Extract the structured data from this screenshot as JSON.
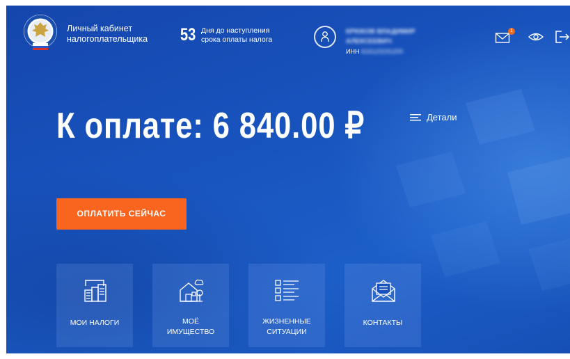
{
  "header": {
    "cabinet_title_line1": "Личный кабинет",
    "cabinet_title_line2": "налогоплательщика",
    "days_count": "53",
    "days_text_line1": "Дня до наступления",
    "days_text_line2": "срока оплаты налога",
    "user_name_line1": "Крюков Владимир",
    "user_name_line2": "Алексеевич",
    "inn_label": "ИНН",
    "inn_value": "616123191200",
    "mail_badge": "1",
    "icons": [
      "mail-icon",
      "eye-icon",
      "logout-icon"
    ]
  },
  "main": {
    "pay_title": "К оплате: 6 840.00 ₽",
    "details_label": "Детали",
    "pay_button": "ОПЛАТИТЬ СЕЙЧАС"
  },
  "tiles": [
    {
      "line1": "МОИ НАЛОГИ",
      "line2": "",
      "icon": "taxes-icon"
    },
    {
      "line1": "МОЁ",
      "line2": "ИМУЩЕСТВО",
      "icon": "property-icon"
    },
    {
      "line1": "ЖИЗНЕННЫЕ",
      "line2": "СИТУАЦИИ",
      "icon": "list-icon"
    },
    {
      "line1": "КОНТАКТЫ",
      "line2": "",
      "icon": "contacts-icon"
    }
  ],
  "colors": {
    "accent": "#f9651e",
    "background": "#1853bd",
    "badge": "#f26a1b"
  }
}
